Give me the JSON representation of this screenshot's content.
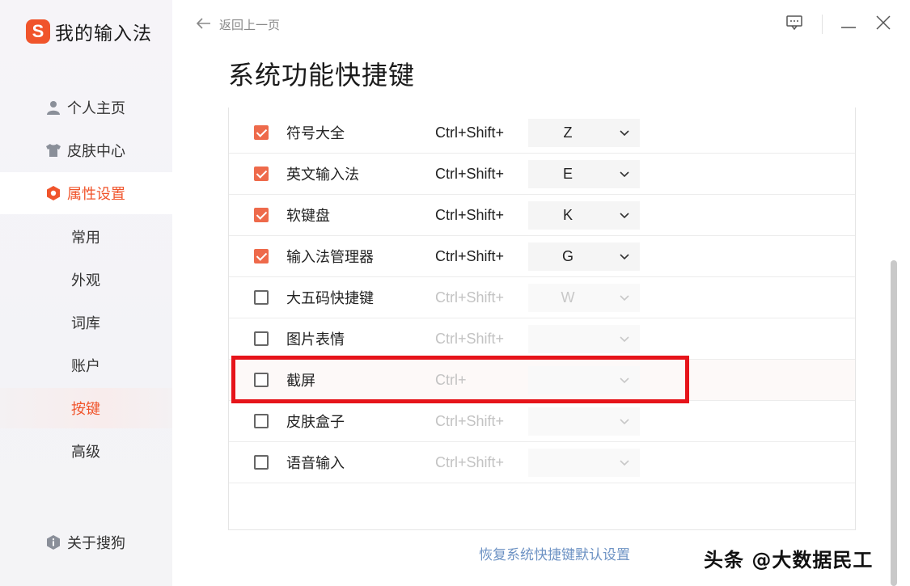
{
  "app": {
    "logo_letter": "S",
    "title": "我的输入法"
  },
  "nav": {
    "items": [
      {
        "label": "个人主页",
        "icon": "user-icon"
      },
      {
        "label": "皮肤中心",
        "icon": "shirt-icon"
      },
      {
        "label": "属性设置",
        "icon": "hexagon-settings-icon"
      }
    ],
    "sub_items": [
      "常用",
      "外观",
      "词库",
      "账户",
      "按键",
      "高级"
    ],
    "about": "关于搜狗"
  },
  "header": {
    "back_label": "返回上一页"
  },
  "page": {
    "title": "系统功能快捷键"
  },
  "shortcuts": [
    {
      "label": "符号大全",
      "checked": true,
      "combo": "Ctrl+Shift+",
      "key": "Z"
    },
    {
      "label": "英文输入法",
      "checked": true,
      "combo": "Ctrl+Shift+",
      "key": "E"
    },
    {
      "label": "软键盘",
      "checked": true,
      "combo": "Ctrl+Shift+",
      "key": "K"
    },
    {
      "label": "输入法管理器",
      "checked": true,
      "combo": "Ctrl+Shift+",
      "key": "G"
    },
    {
      "label": "大五码快捷键",
      "checked": false,
      "combo": "Ctrl+Shift+",
      "key": "W"
    },
    {
      "label": "图片表情",
      "checked": false,
      "combo": "Ctrl+Shift+",
      "key": ""
    },
    {
      "label": "截屏",
      "checked": false,
      "combo": "Ctrl+",
      "key": ""
    },
    {
      "label": "皮肤盒子",
      "checked": false,
      "combo": "Ctrl+Shift+",
      "key": ""
    },
    {
      "label": "语音输入",
      "checked": false,
      "combo": "Ctrl+Shift+",
      "key": ""
    }
  ],
  "footer": {
    "restore_label": "恢复系统快捷键默认设置"
  },
  "watermark": "头条 @大数据民工",
  "colors": {
    "accent": "#f0542b",
    "checkbox": "#ee6a4b",
    "highlight_box": "#e6141a",
    "link": "#6e93c4"
  }
}
